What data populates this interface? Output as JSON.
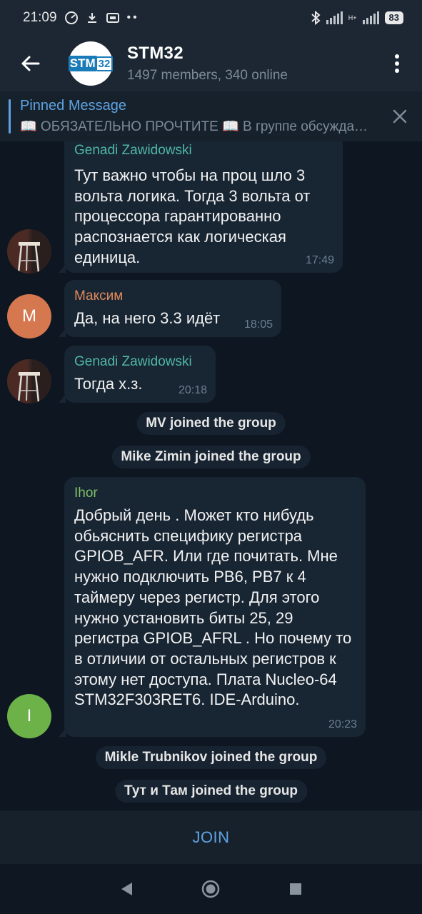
{
  "status_bar": {
    "time": "21:09",
    "network_type": "H+",
    "battery": "83"
  },
  "header": {
    "title": "STM32",
    "subtitle": "1497 members, 340 online",
    "logo_text_1": "STM",
    "logo_text_2": "32"
  },
  "pinned": {
    "title": "Pinned Message",
    "text": "📖 ОБЯЗАТЕЛЬНО ПРОЧТИТЕ 📖  В группе обсуждается"
  },
  "messages": [
    {
      "sender": "Genadi Zawidowski",
      "sender_color": "#4fb8a8",
      "text": "Тут важно чтобы на проц шло 3 вольта логика. Тогда 3 вольта от процессора гарантированно распознается как логическая единица.",
      "time": "17:49"
    },
    {
      "sender": "Максим",
      "sender_color": "#e08a5c",
      "avatar_letter": "М",
      "avatar_color": "#d5774f",
      "text": "Да, на него 3.3 идёт",
      "time": "18:05"
    },
    {
      "sender": "Genadi Zawidowski",
      "sender_color": "#4fb8a8",
      "text": "Тогда х.з.",
      "time": "20:18"
    },
    {
      "sender": "Ihor",
      "sender_color": "#7fc16a",
      "avatar_letter": "I",
      "avatar_color": "#6cb249",
      "text": "Добрый день . Может кто нибудь обьяснить специфику регистра GPIOB_AFR. Или где почитать. Мне нужно подключить PB6, PB7 к 4 таймеру через регистр. Для этого нужно установить биты 25, 29 регистра GPIOB_AFRL . Но почему то в отличии от остальных регистров к этому нет доступа. Плата Nucleo-64 STM32F303RET6. IDE-Arduino.",
      "time": "20:23"
    }
  ],
  "service_messages": [
    "MV joined the group",
    "Mike Zimin joined the group",
    "Mikle Trubnikov joined the group",
    "Тут и Там joined the group"
  ],
  "join_bar": {
    "label": "JOIN"
  },
  "colors": {
    "background": "#0e1621",
    "bubble": "#182533",
    "accent": "#5ea3e3"
  }
}
